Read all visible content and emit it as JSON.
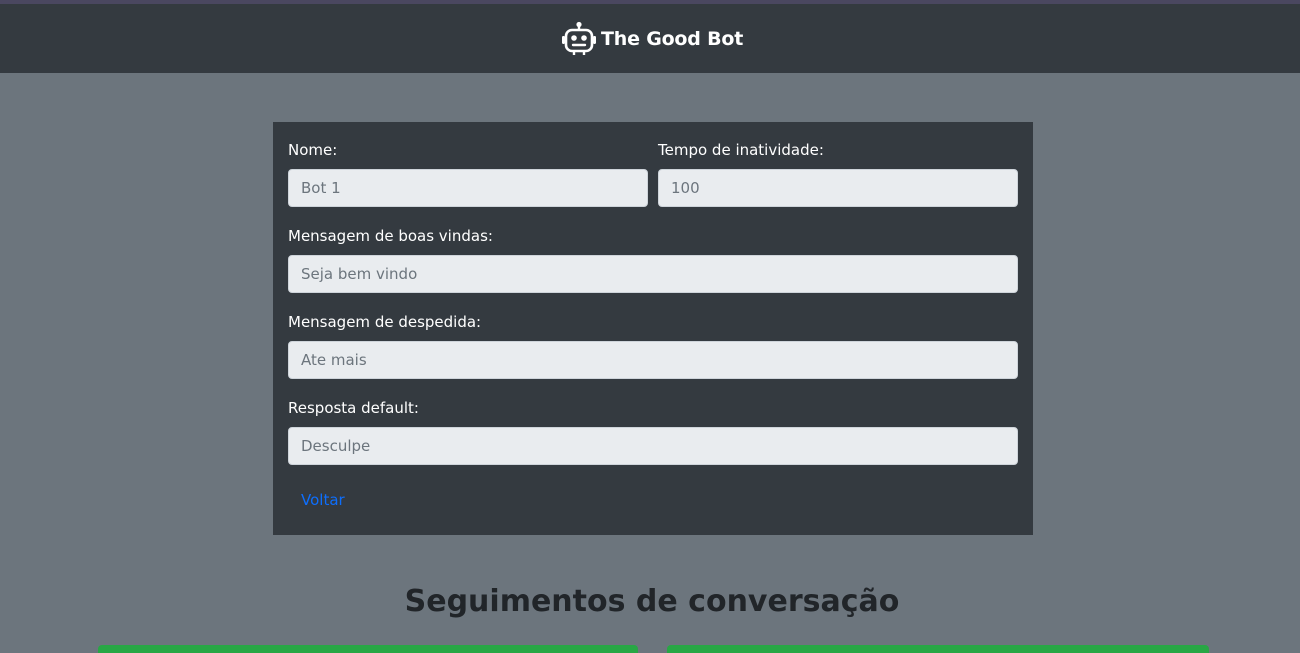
{
  "navbar": {
    "brand_text": "The Good Bot",
    "brand_icon": "robot-icon"
  },
  "form": {
    "name_label": "Nome:",
    "name_placeholder": "Bot 1",
    "timeout_label": "Tempo de inatividade:",
    "timeout_placeholder": "100",
    "welcome_label": "Mensagem de boas vindas:",
    "welcome_placeholder": "Seja bem vindo",
    "farewell_label": "Mensagem de despedida:",
    "farewell_placeholder": "Ate mais",
    "default_label": "Resposta default:",
    "default_placeholder": "Desculpe",
    "back_label": "Voltar"
  },
  "segments": {
    "title": "Seguimentos de conversação"
  },
  "colors": {
    "navbar_bg": "#343a40",
    "page_bg": "#6c757d",
    "card_bg": "#343a40",
    "link": "#0d6efd",
    "success": "#28a745"
  }
}
